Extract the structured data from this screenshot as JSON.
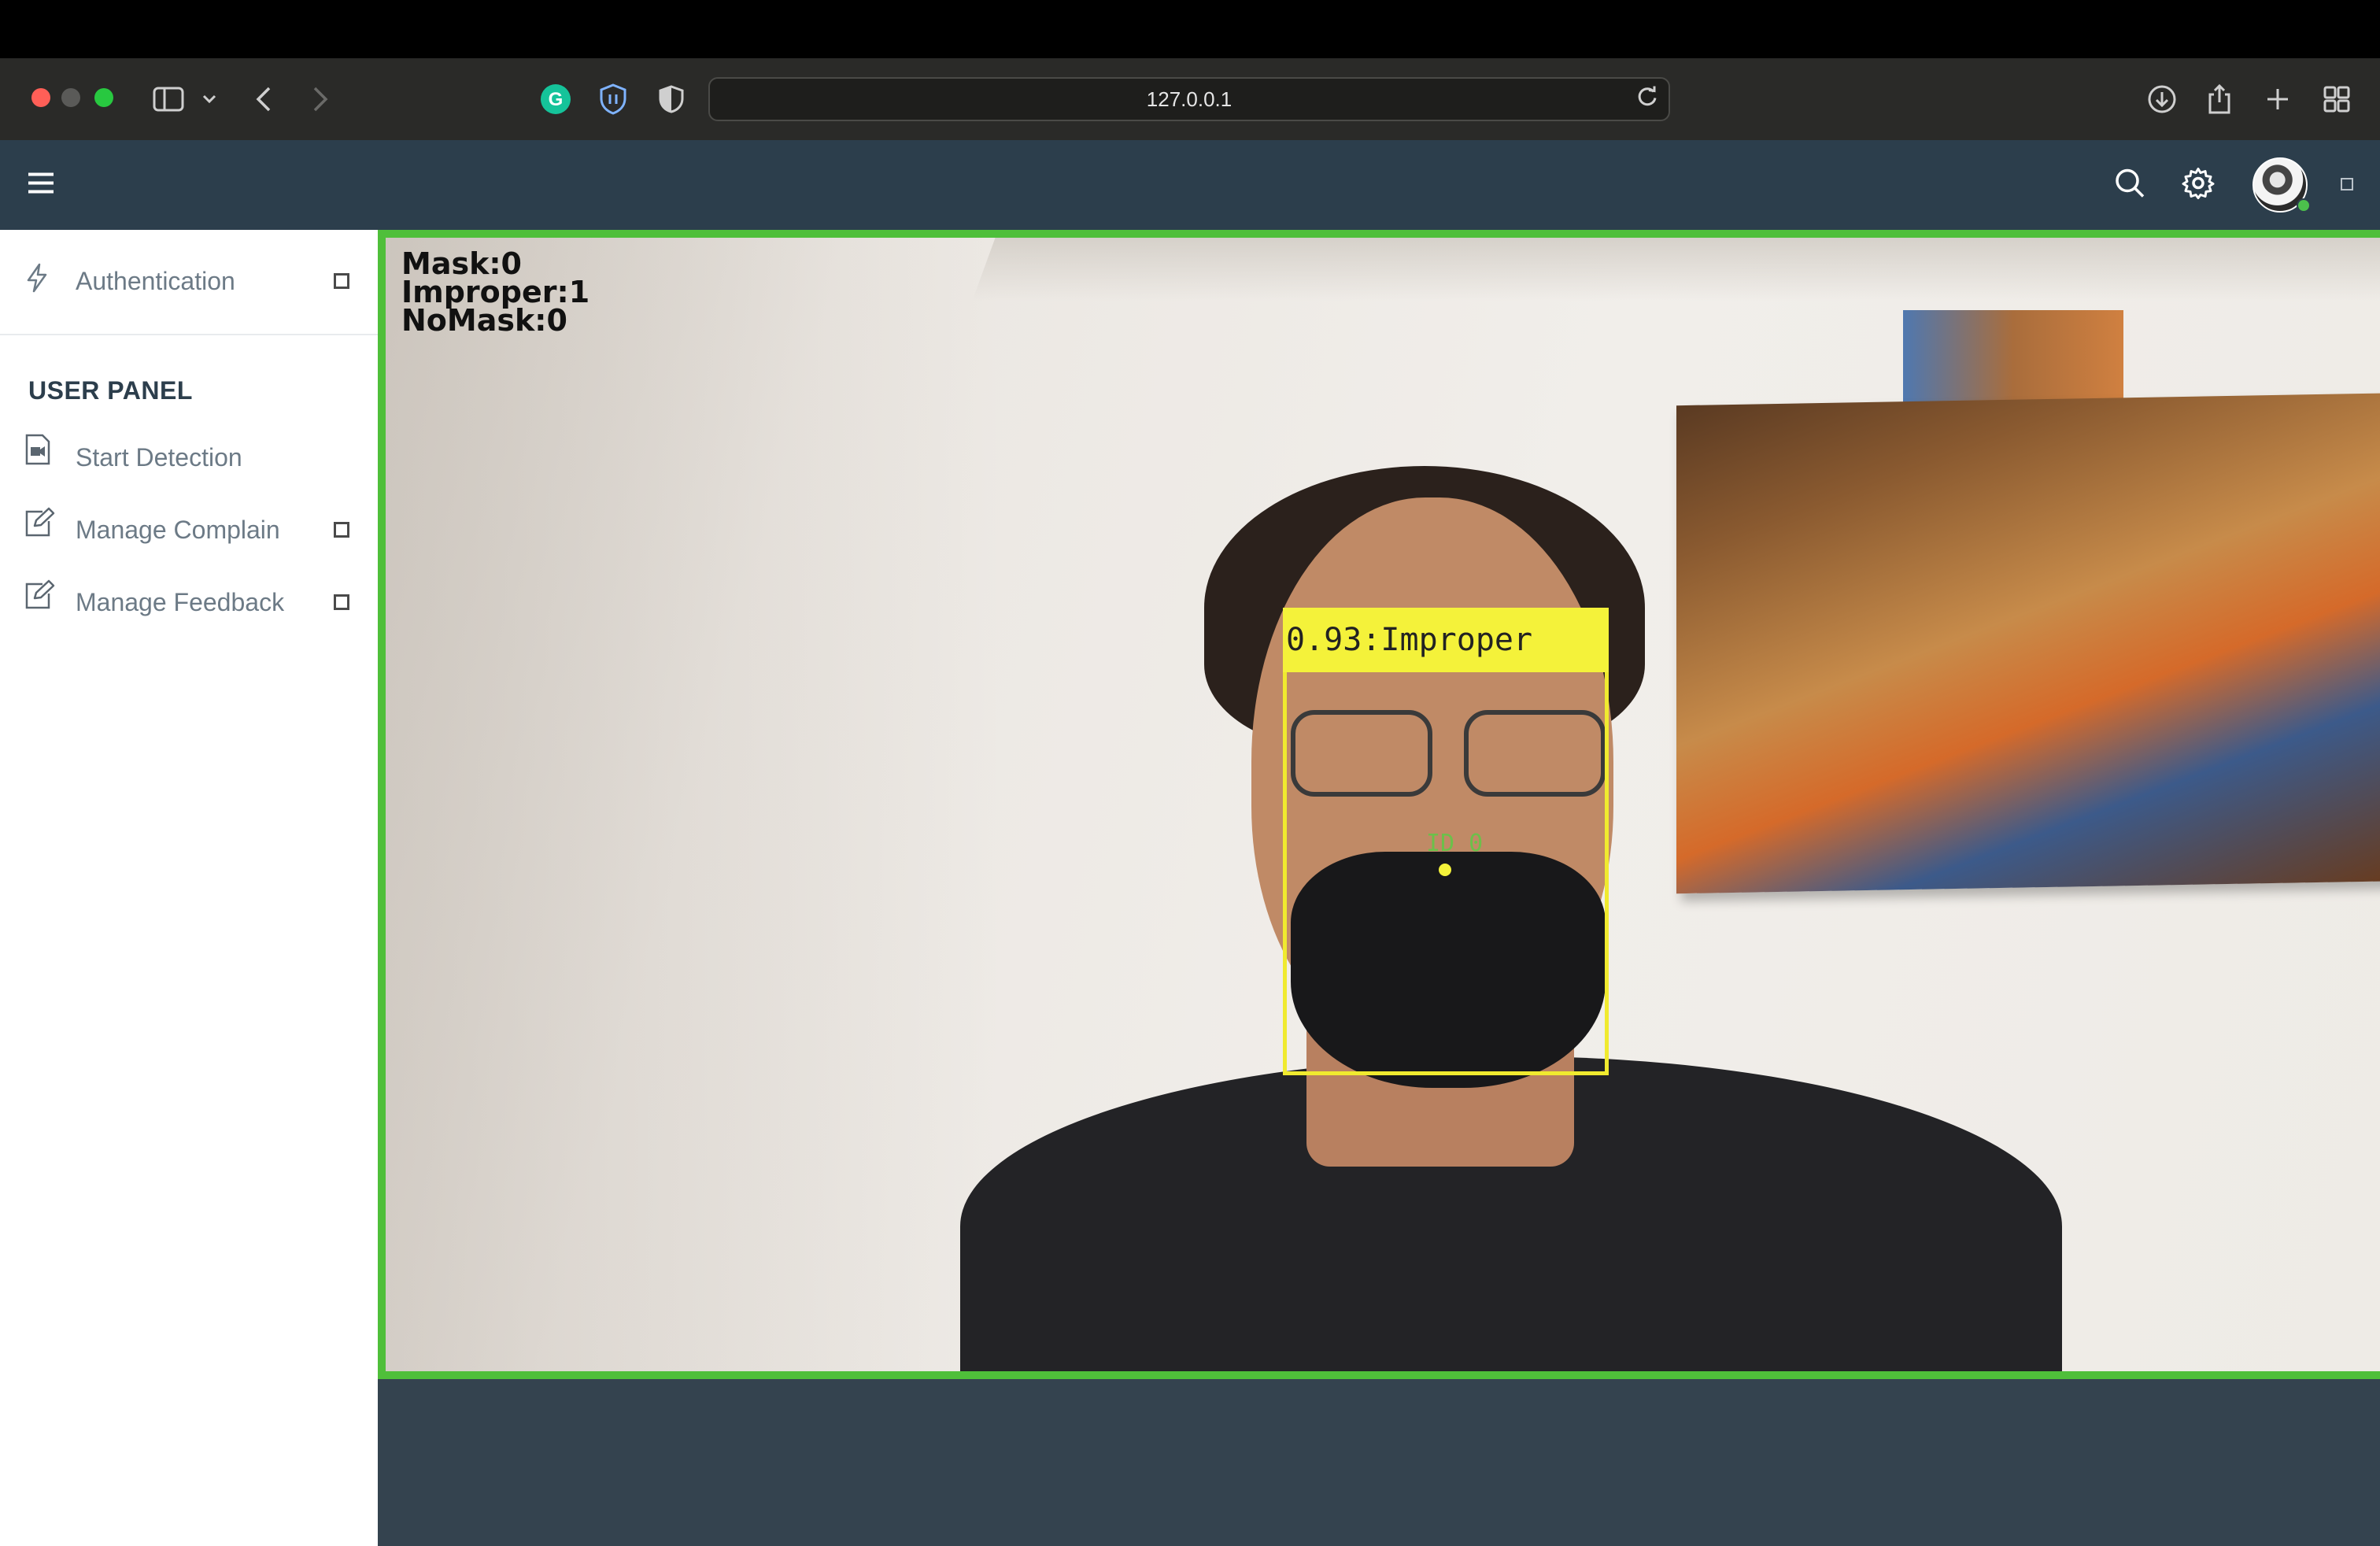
{
  "browser": {
    "url": "127.0.0.1"
  },
  "sidebar": {
    "top_item": {
      "label": "Authentication",
      "icon": "lightning-icon"
    },
    "panel_title": "USER PANEL",
    "items": [
      {
        "label": "Start Detection",
        "icon": "video-file-icon",
        "has_toggle": false
      },
      {
        "label": "Manage Complain",
        "icon": "edit-icon",
        "has_toggle": true
      },
      {
        "label": "Manage Feedback",
        "icon": "edit-icon",
        "has_toggle": true
      }
    ]
  },
  "detection": {
    "counters": {
      "mask": "Mask:0",
      "improper": "Improper:1",
      "nomask": "NoMask:0"
    },
    "box_label": "0.93:Improper",
    "track_id": "ID 0"
  },
  "colors": {
    "header_bg": "#2c3e4c",
    "frame_border": "#4fbf3a",
    "detect_box": "#f0ea2f",
    "track_id": "#6cc04a"
  }
}
